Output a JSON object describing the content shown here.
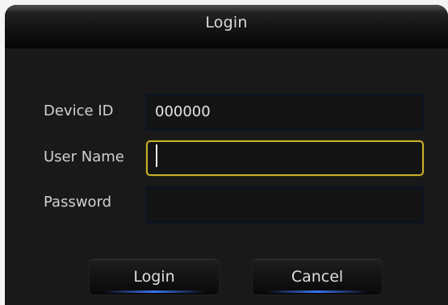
{
  "dialog": {
    "title": "Login",
    "fields": {
      "device_id": {
        "label": "Device ID",
        "value": "000000"
      },
      "user_name": {
        "label": "User Name",
        "value": ""
      },
      "password": {
        "label": "Password",
        "value": ""
      }
    },
    "buttons": {
      "login": "Login",
      "cancel": "Cancel"
    }
  }
}
